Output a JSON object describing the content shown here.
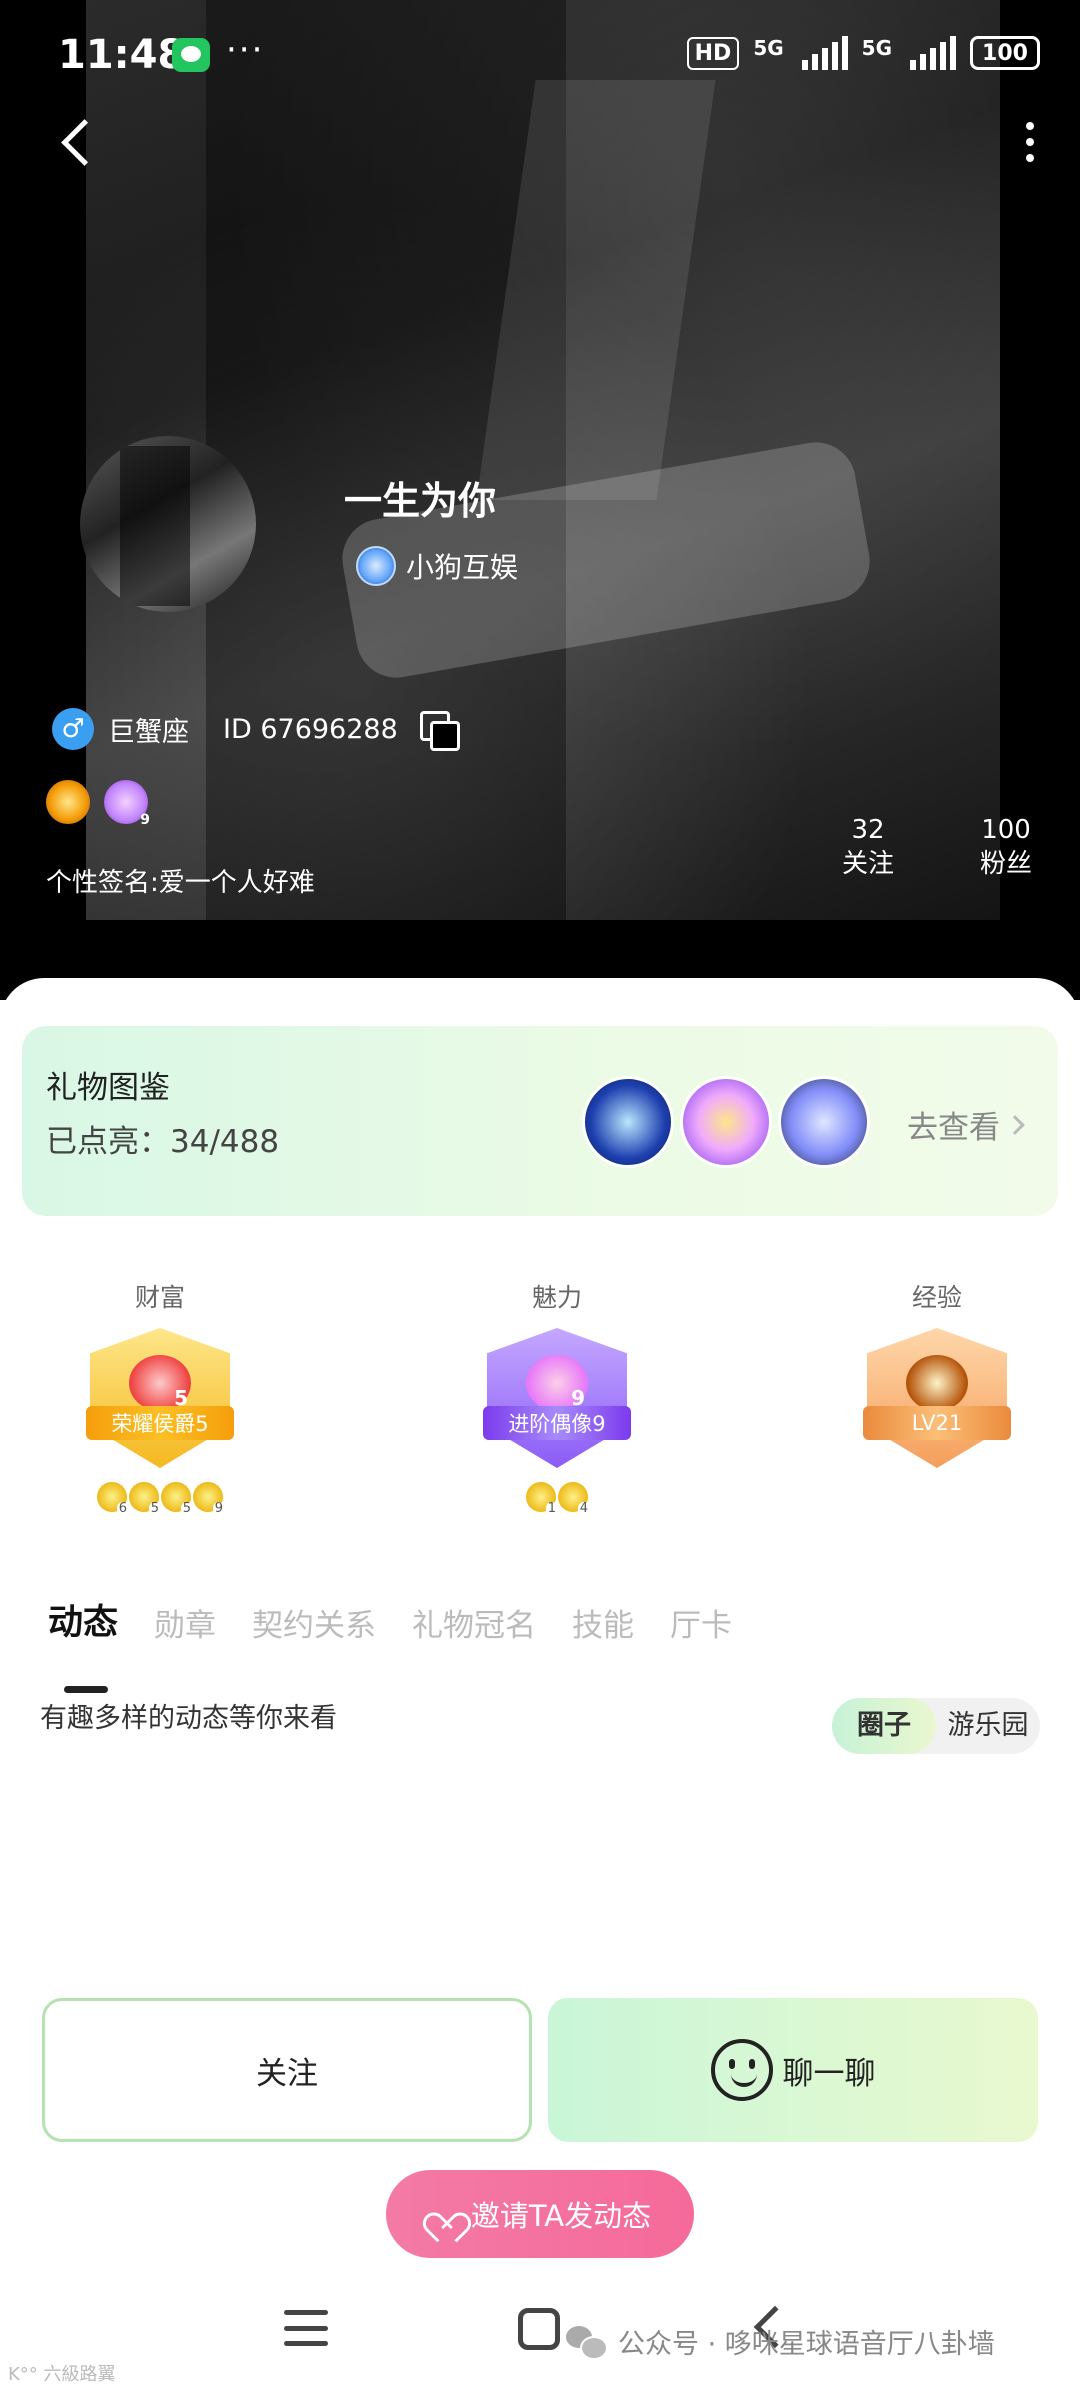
{
  "status_bar": {
    "time": "11:48",
    "more": "···",
    "hd": "HD",
    "net1": "5G",
    "net2": "5G",
    "battery": "100"
  },
  "profile": {
    "nickname": "一生为你",
    "guild": "小狗互娱",
    "zodiac": "巨蟹座",
    "id_text": "ID 67696288",
    "gender_symbol": "♂",
    "charm_badge_level": "9",
    "signature": "个性签名:爱一个人好难",
    "following": {
      "count": "32",
      "label": "关注"
    },
    "fans": {
      "count": "100",
      "label": "粉丝"
    }
  },
  "gift_gallery": {
    "title": "礼物图鉴",
    "lit_count": "已点亮：34/488",
    "view_more": "去查看"
  },
  "levels": [
    {
      "title": "财富",
      "badge_text": "荣耀侯爵5",
      "num": "5",
      "sub": [
        "6",
        "5",
        "5",
        "9"
      ]
    },
    {
      "title": "魅力",
      "badge_text": "进阶偶像9",
      "num": "9",
      "sub": [
        "1",
        "4"
      ]
    },
    {
      "title": "经验",
      "badge_text": "LV21",
      "num": "",
      "sub": []
    }
  ],
  "tabs": [
    "动态",
    "勋章",
    "契约关系",
    "礼物冠名",
    "技能",
    "厅卡"
  ],
  "feed": {
    "hint": "有趣多样的动态等你来看",
    "switch": [
      "圈子",
      "游乐园"
    ]
  },
  "actions": {
    "follow": "关注",
    "chat": "聊一聊",
    "invite": "邀请TA发动态"
  },
  "watermark": {
    "text": "公众号 · 哆咪星球语音厅八卦墙",
    "left_text": "K°° 六級路翼"
  },
  "colors": {
    "accent_green": "#c9f6d8",
    "invite_pink": "#f47aa5",
    "gender_blue": "#3b9ff1"
  }
}
